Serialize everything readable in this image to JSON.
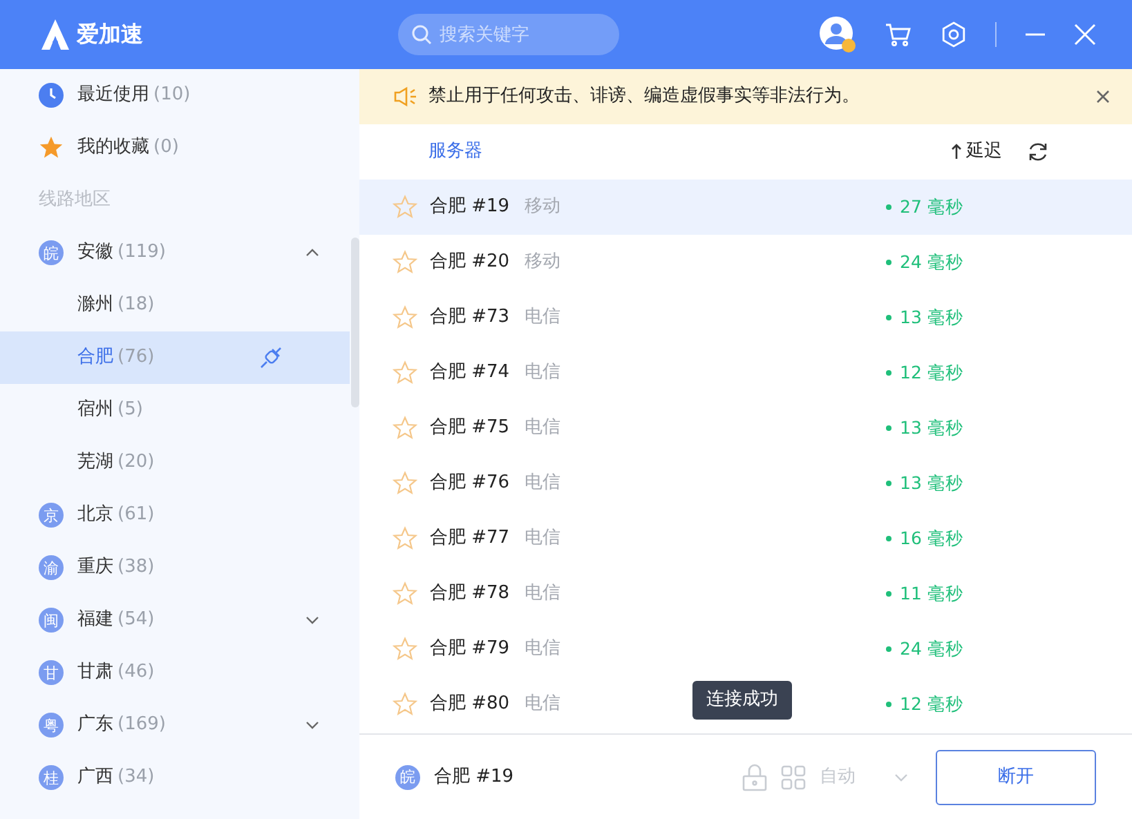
{
  "app": {
    "title": "爱加速"
  },
  "search": {
    "placeholder": "搜索关键字"
  },
  "sidebar": {
    "items": [
      {
        "kind": "recent",
        "label": "最近使用",
        "count": "(10)",
        "selected": false
      },
      {
        "kind": "favorites",
        "label": "我的收藏",
        "count": "(0)",
        "selected": false
      },
      {
        "kind": "section",
        "label": "线路地区"
      },
      {
        "kind": "province",
        "badge": "皖",
        "label": "安徽",
        "count": "(119)",
        "expanded": true,
        "selected": false,
        "children": [
          {
            "label": "滁州",
            "count": "(18)",
            "selected": false
          },
          {
            "label": "合肥",
            "count": "(76)",
            "selected": true
          },
          {
            "label": "宿州",
            "count": "(5)",
            "selected": false
          },
          {
            "label": "芜湖",
            "count": "(20)",
            "selected": false
          }
        ]
      },
      {
        "kind": "province",
        "badge": "京",
        "label": "北京",
        "count": "(61)",
        "selected": false
      },
      {
        "kind": "province",
        "badge": "渝",
        "label": "重庆",
        "count": "(38)",
        "selected": false
      },
      {
        "kind": "province",
        "badge": "闽",
        "label": "福建",
        "count": "(54)",
        "expanded": false,
        "selected": false
      },
      {
        "kind": "province",
        "badge": "甘",
        "label": "甘肃",
        "count": "(46)",
        "selected": false
      },
      {
        "kind": "province",
        "badge": "粤",
        "label": "广东",
        "count": "(169)",
        "expanded": false,
        "selected": false
      },
      {
        "kind": "province",
        "badge": "桂",
        "label": "广西",
        "count": "(34)",
        "selected": false
      }
    ]
  },
  "notice": {
    "text": "禁止用于任何攻击、诽谤、编造虚假事实等非法行为。"
  },
  "server_list": {
    "columns": [
      "服务器",
      "延迟"
    ],
    "rows": [
      {
        "name": "合肥 #19",
        "carrier": "移动",
        "latency": "27 毫秒",
        "selected": true,
        "favorite": false
      },
      {
        "name": "合肥 #20",
        "carrier": "移动",
        "latency": "24 毫秒",
        "selected": false,
        "favorite": false
      },
      {
        "name": "合肥 #73",
        "carrier": "电信",
        "latency": "13 毫秒",
        "selected": false,
        "favorite": false
      },
      {
        "name": "合肥 #74",
        "carrier": "电信",
        "latency": "12 毫秒",
        "selected": false,
        "favorite": false
      },
      {
        "name": "合肥 #75",
        "carrier": "电信",
        "latency": "13 毫秒",
        "selected": false,
        "favorite": false
      },
      {
        "name": "合肥 #76",
        "carrier": "电信",
        "latency": "13 毫秒",
        "selected": false,
        "favorite": false
      },
      {
        "name": "合肥 #77",
        "carrier": "电信",
        "latency": "16 毫秒",
        "selected": false,
        "favorite": false
      },
      {
        "name": "合肥 #78",
        "carrier": "电信",
        "latency": "11 毫秒",
        "selected": false,
        "favorite": false
      },
      {
        "name": "合肥 #79",
        "carrier": "电信",
        "latency": "24 毫秒",
        "selected": false,
        "favorite": false
      },
      {
        "name": "合肥 #80",
        "carrier": "电信",
        "latency": "12 毫秒",
        "selected": false,
        "favorite": false
      }
    ]
  },
  "tooltip": {
    "text": "连接成功"
  },
  "status_bar": {
    "badge": "皖",
    "server": "合肥 #19",
    "mode": "自动",
    "button": "断开"
  }
}
